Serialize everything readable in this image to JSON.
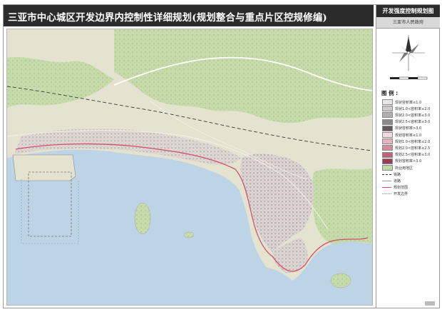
{
  "title": "三亚市中心城区开发边界内控制性详细规划(规划整合与重点片区控规修编)",
  "sidebar": {
    "title": "开发强度控制规划图",
    "subtitle": "三亚市人民政府"
  },
  "legend": {
    "heading": "图  例 :",
    "items": [
      {
        "label": "现状容积率≤1.0",
        "color": "#e9e6e6"
      },
      {
        "label": "现状1.0<容积率≤2.0",
        "color": "#cfcbcb"
      },
      {
        "label": "现状2.0<容积率≤3.0",
        "color": "#b3aeae"
      },
      {
        "label": "现状2.5<容积率≤3.0",
        "color": "#8f8a8a"
      },
      {
        "label": "现状容积率>3.0",
        "color": "#5f5b5b"
      },
      {
        "label": "规划容积率≤1.0",
        "color": "#f3dbe1"
      },
      {
        "label": "规划1.0<容积率≤2.0",
        "color": "#e5b3bf"
      },
      {
        "label": "规划2.0<容积率≤2.5",
        "color": "#d48c9c"
      },
      {
        "label": "规划2.5<容积率≤3.0",
        "color": "#bd6479"
      },
      {
        "label": "规划容积率>3.0",
        "color": "#9c3d54"
      },
      {
        "label": "商业用地区",
        "color": "#bfd8a5"
      }
    ],
    "lines": [
      {
        "label": "铁路",
        "color": "#333333",
        "style": "dashed"
      },
      {
        "label": "道路",
        "color": "#999999",
        "style": "solid"
      },
      {
        "label": "规划范围",
        "color": "#d0506b",
        "style": "solid"
      },
      {
        "label": "开发边界",
        "color": "#888888",
        "style": "dotted"
      }
    ]
  },
  "colors": {
    "sea": "#bcd3e6",
    "land": "#e6e4d3",
    "vegetation": "#c5d9a9",
    "header": "#2b2b2b"
  }
}
